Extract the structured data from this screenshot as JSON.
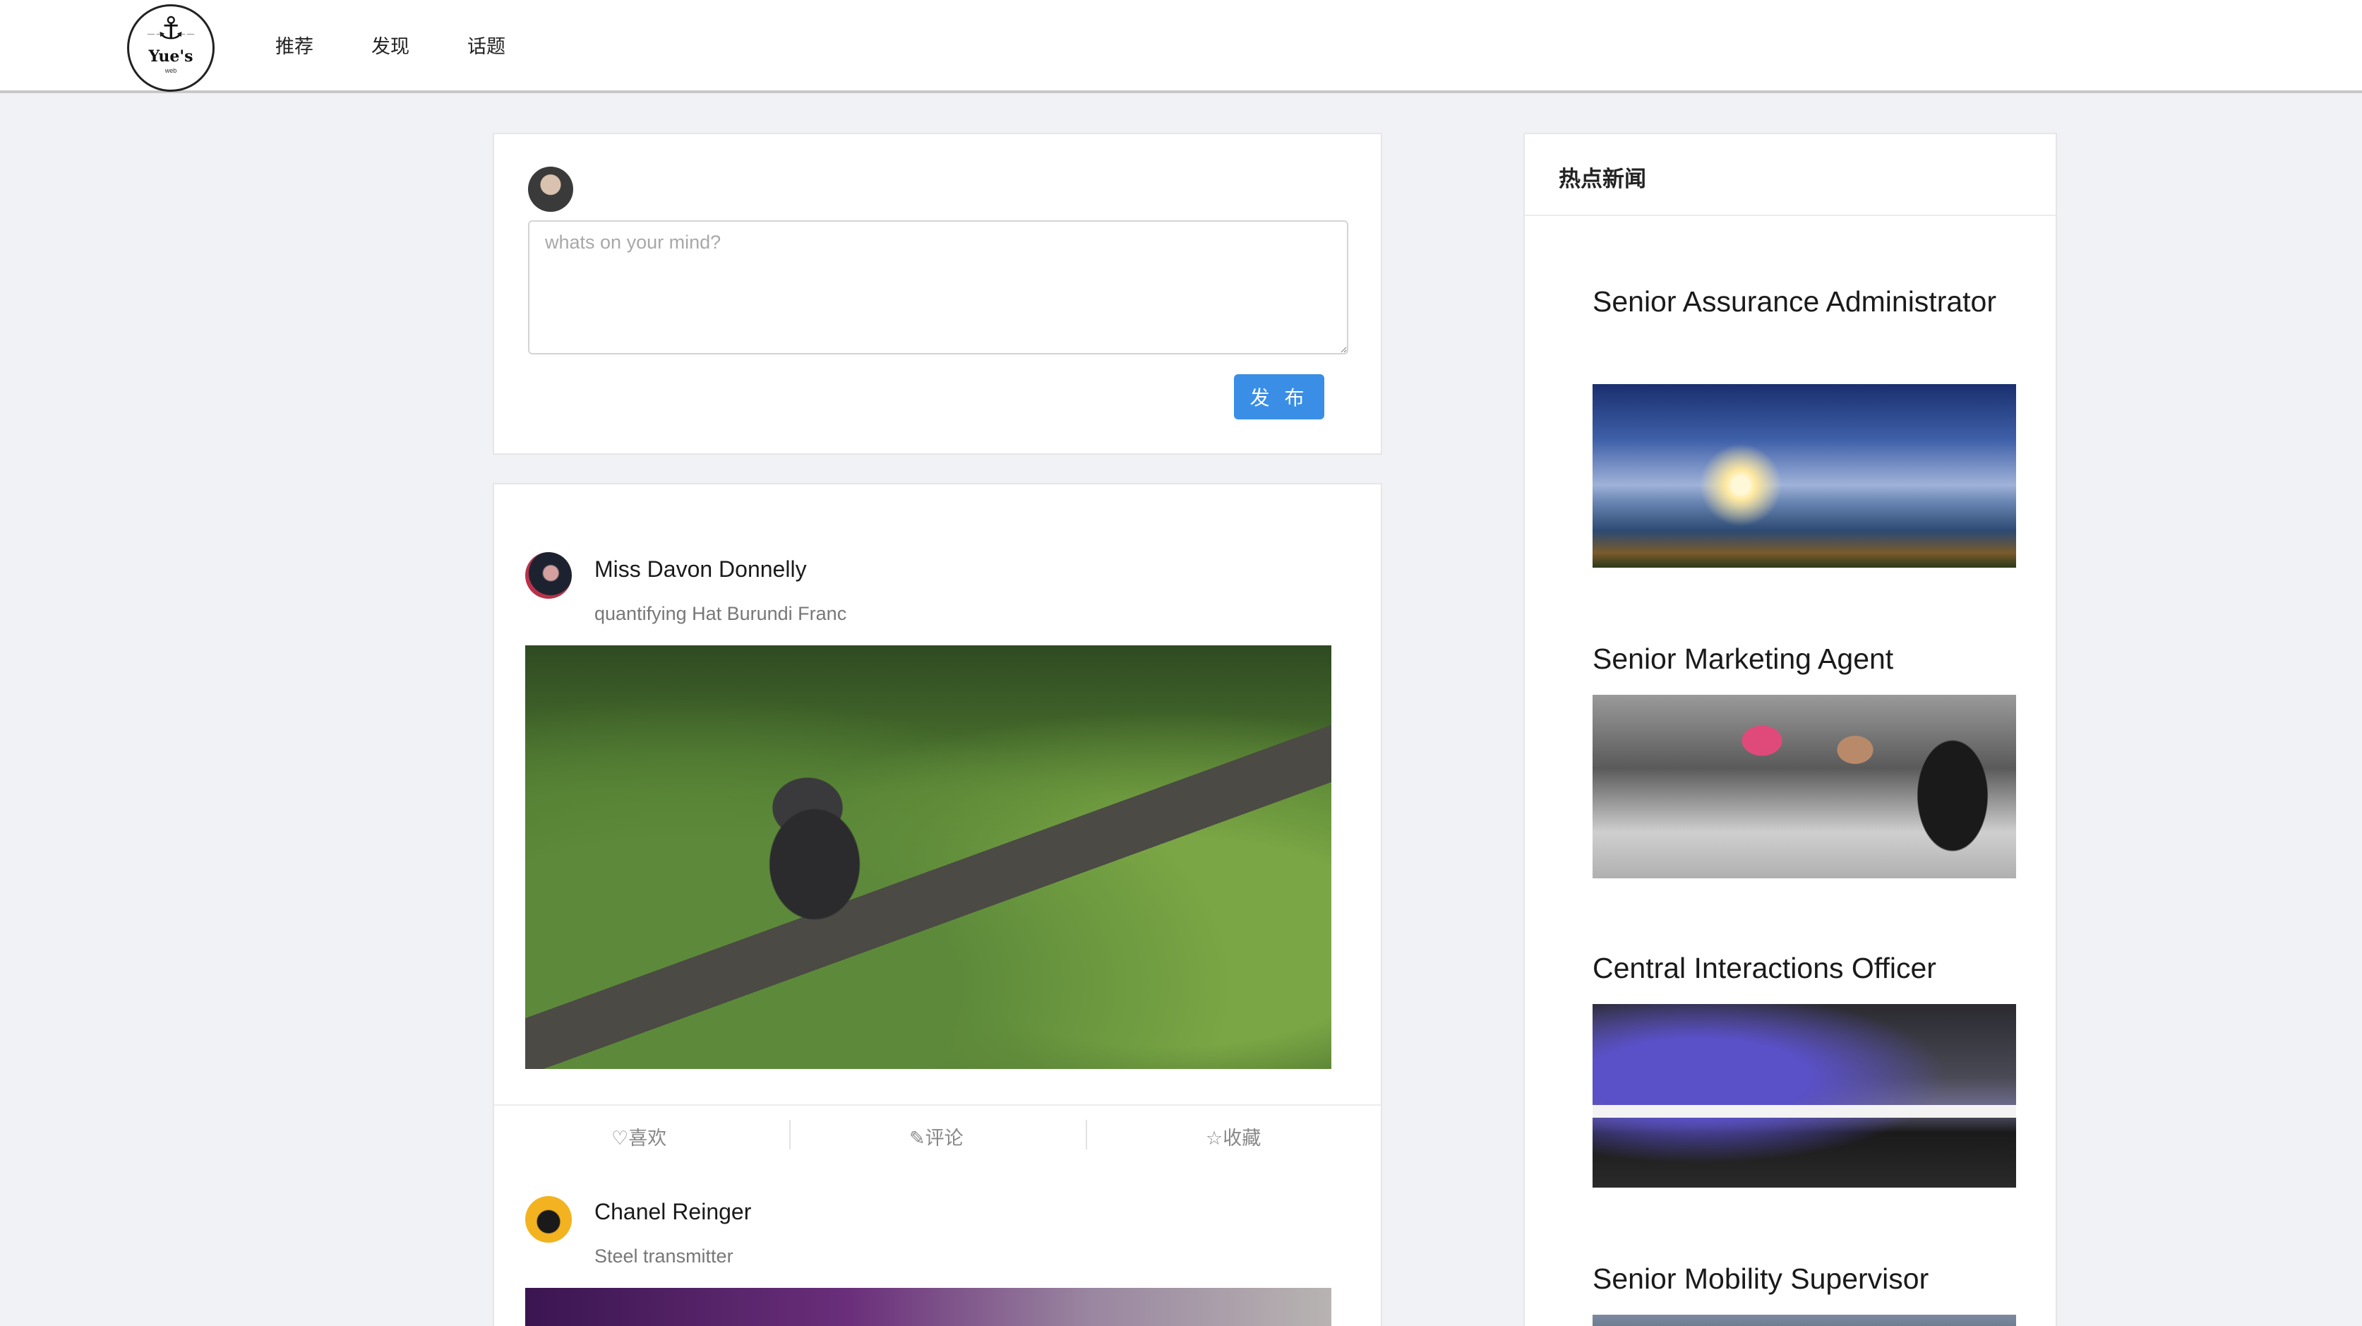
{
  "header": {
    "logo": {
      "name": "Yue's",
      "sub": "web"
    },
    "nav": [
      {
        "label": "推荐"
      },
      {
        "label": "发现"
      },
      {
        "label": "话题"
      }
    ]
  },
  "composer": {
    "placeholder": "whats on your mind?",
    "publish_label": "发 布"
  },
  "feed": {
    "posts": [
      {
        "author": "Miss Davon Donnelly",
        "text": "quantifying Hat Burundi Franc"
      },
      {
        "author": "Chanel Reinger",
        "text": "Steel transmitter"
      }
    ],
    "actions": {
      "like": "♡喜欢",
      "comment": "✎评论",
      "favorite": "☆收藏"
    }
  },
  "sidebar": {
    "title": "热点新闻",
    "news": [
      {
        "title": "Senior Assurance Administrator"
      },
      {
        "title": "Senior Marketing Agent"
      },
      {
        "title": "Central Interactions Officer"
      },
      {
        "title": "Senior Mobility Supervisor"
      }
    ]
  }
}
